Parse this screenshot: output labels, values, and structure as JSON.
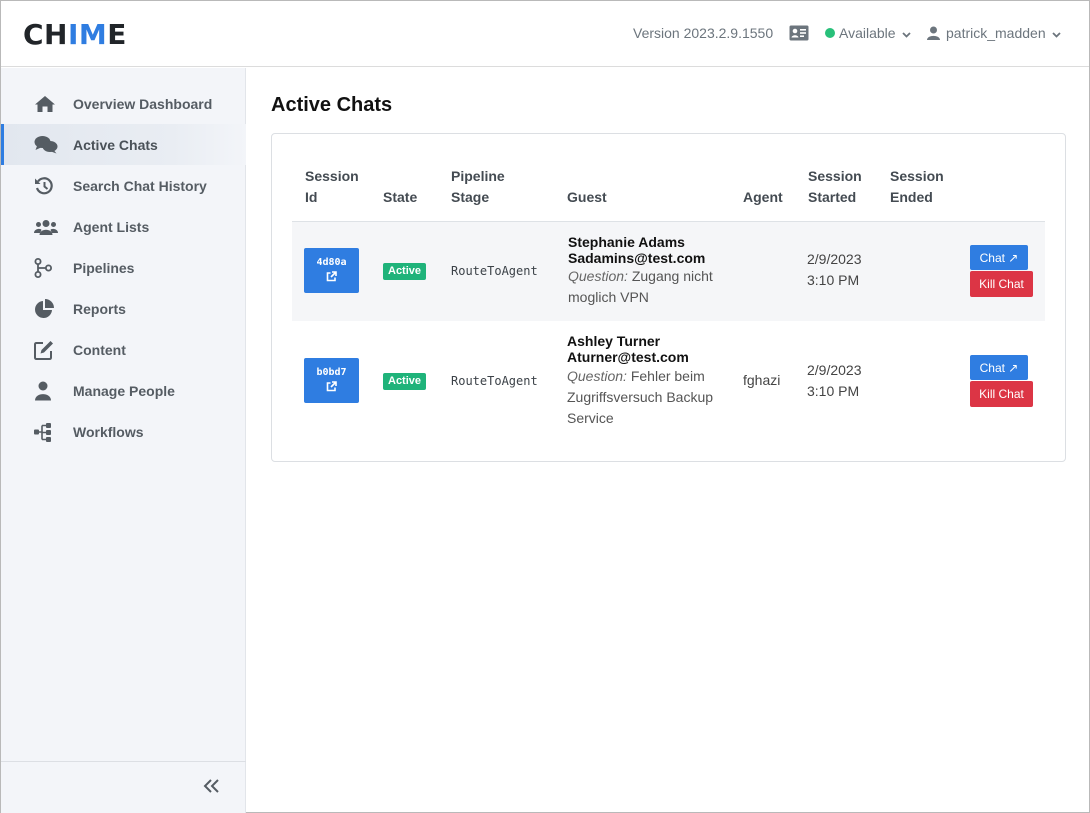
{
  "app": {
    "logo_left": "CH",
    "logo_accent": "IM",
    "logo_right": "E"
  },
  "header": {
    "version": "Version 2023.2.9.1550",
    "status": "Available",
    "status_color": "#28c07a",
    "user": "patrick_madden"
  },
  "sidebar": {
    "items": [
      {
        "label": "Overview Dashboard",
        "icon": "home-icon"
      },
      {
        "label": "Active Chats",
        "icon": "chats-icon",
        "active": true
      },
      {
        "label": "Search Chat History",
        "icon": "history-icon"
      },
      {
        "label": "Agent Lists",
        "icon": "users-icon"
      },
      {
        "label": "Pipelines",
        "icon": "pipeline-icon"
      },
      {
        "label": "Reports",
        "icon": "pie-chart-icon"
      },
      {
        "label": "Content",
        "icon": "edit-icon"
      },
      {
        "label": "Manage People",
        "icon": "person-icon"
      },
      {
        "label": "Workflows",
        "icon": "workflow-icon"
      }
    ],
    "collapse_icon": "double-chevron-left-icon"
  },
  "main": {
    "title": "Active Chats",
    "table": {
      "headers": {
        "session_id": [
          "Session",
          "Id"
        ],
        "state": "State",
        "pipeline_stage": [
          "Pipeline",
          "Stage"
        ],
        "guest": "Guest",
        "agent": "Agent",
        "session_started": [
          "Session",
          "Started"
        ],
        "session_ended": [
          "Session",
          "Ended"
        ]
      },
      "rows": [
        {
          "session_id": "4d80a",
          "state": "Active",
          "pipeline_stage": "RouteToAgent",
          "guest_name": "Stephanie Adams",
          "guest_email": "Sadamins@test.com",
          "question_label": "Question:",
          "question": "Zugang nicht moglich VPN",
          "agent": "",
          "started_date": "2/9/2023",
          "started_time": "3:10 PM",
          "ended": "",
          "chat_label": "Chat ↗",
          "kill_label": "Kill Chat"
        },
        {
          "session_id": "b0bd7",
          "state": "Active",
          "pipeline_stage": "RouteToAgent",
          "guest_name": "Ashley Turner",
          "guest_email": "Aturner@test.com",
          "question_label": "Question:",
          "question": "Fehler beim Zugriffsversuch Backup Service",
          "agent": "fghazi",
          "started_date": "2/9/2023",
          "started_time": "3:10 PM",
          "ended": "",
          "chat_label": "Chat ↗",
          "kill_label": "Kill Chat"
        }
      ]
    }
  },
  "colors": {
    "primary": "#2f7de1",
    "danger": "#dc3545",
    "success": "#1fb37a"
  }
}
